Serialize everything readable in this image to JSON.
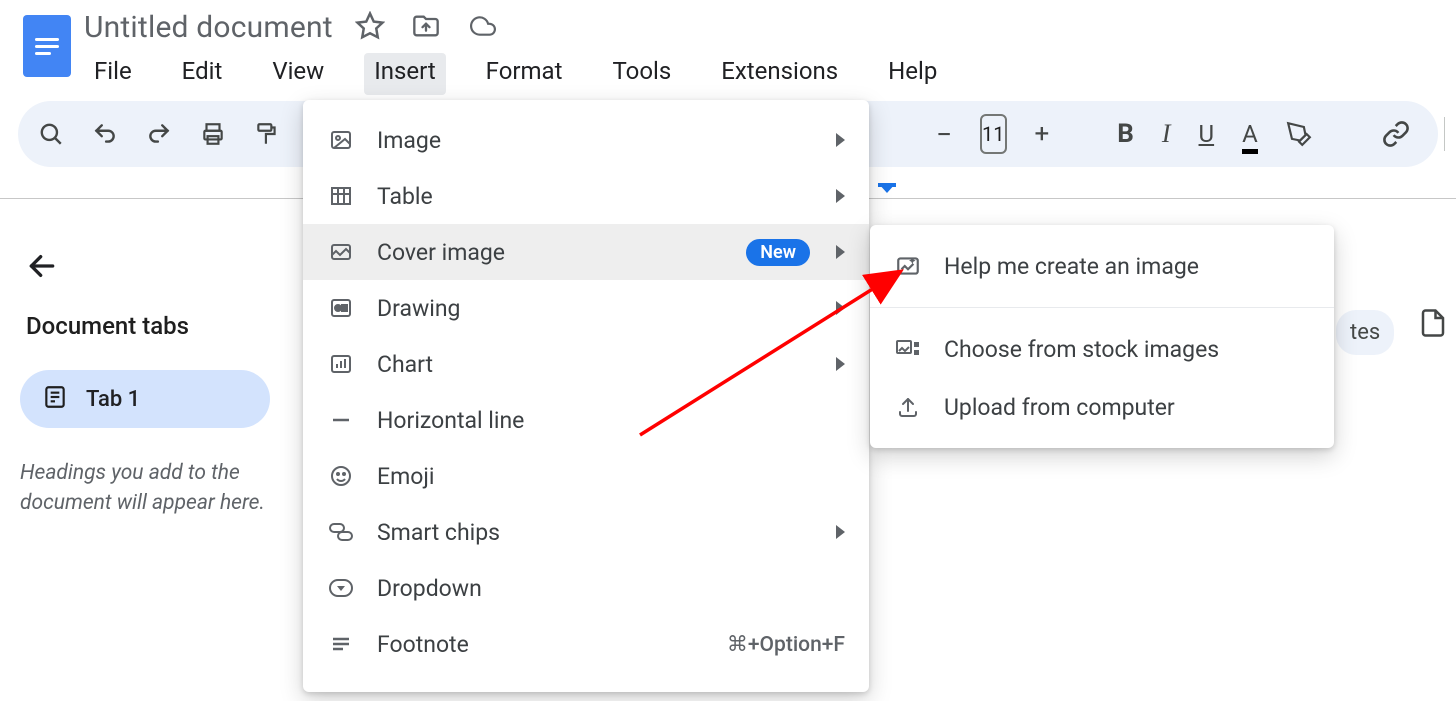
{
  "header": {
    "doc_title": "Untitled document",
    "menus": [
      "File",
      "Edit",
      "View",
      "Insert",
      "Format",
      "Tools",
      "Extensions",
      "Help"
    ],
    "active_menu_index": 3
  },
  "toolbar": {
    "font_size": "11"
  },
  "side_panel": {
    "title": "Document tabs",
    "tab_label": "Tab 1",
    "hint": "Headings you add to the document will appear here."
  },
  "insert_menu": {
    "items": [
      {
        "icon": "image-icon",
        "label": "Image",
        "submenu": true
      },
      {
        "icon": "table-icon",
        "label": "Table",
        "submenu": true
      },
      {
        "icon": "cover-image-icon",
        "label": "Cover image",
        "badge": "New",
        "submenu": true,
        "hovered": true
      },
      {
        "icon": "drawing-icon",
        "label": "Drawing",
        "submenu": true
      },
      {
        "icon": "chart-icon",
        "label": "Chart",
        "submenu": true
      },
      {
        "icon": "hr-icon",
        "label": "Horizontal line"
      },
      {
        "icon": "emoji-icon",
        "label": "Emoji"
      },
      {
        "icon": "chips-icon",
        "label": "Smart chips",
        "submenu": true
      },
      {
        "icon": "dropdown-icon",
        "label": "Dropdown"
      },
      {
        "icon": "footnote-icon",
        "label": "Footnote",
        "shortcut": "⌘+Option+F"
      }
    ]
  },
  "cover_image_submenu": {
    "items": [
      {
        "icon": "ai-image-icon",
        "label": "Help me create an image"
      },
      {
        "icon": "stock-icon",
        "label": "Choose from stock images"
      },
      {
        "icon": "upload-icon",
        "label": "Upload from computer"
      }
    ]
  },
  "peek": {
    "text": "tes"
  }
}
